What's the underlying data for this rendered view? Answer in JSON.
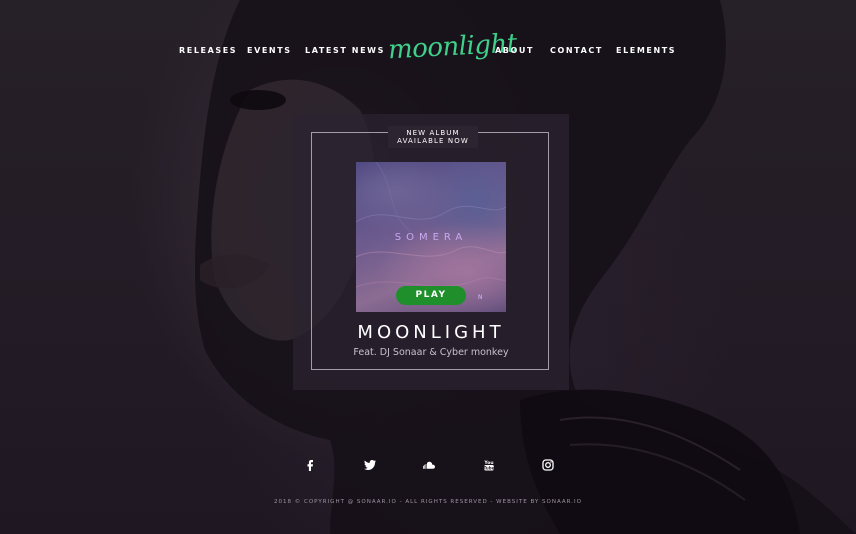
{
  "nav": {
    "left_items": [
      {
        "label": "RELEASES"
      },
      {
        "label": "EVENTS"
      },
      {
        "label": "LATEST NEWS"
      }
    ],
    "logo": "moonlight",
    "right_items": [
      {
        "label": "ABOUT"
      },
      {
        "label": "CONTACT"
      },
      {
        "label": "ELEMENTS"
      }
    ]
  },
  "album": {
    "label_line1": "NEW ALBUM",
    "label_line2": "AVAILABLE NOW",
    "cover_title": "SOMERA",
    "cover_mark": "N",
    "play_label": "PLAY",
    "title": "MOONLIGHT",
    "subtitle": "Feat. DJ Sonaar & Cyber monkey"
  },
  "social": [
    {
      "icon": "facebook-icon"
    },
    {
      "icon": "twitter-icon"
    },
    {
      "icon": "soundcloud-icon"
    },
    {
      "icon": "youtube-icon"
    },
    {
      "icon": "instagram-icon"
    }
  ],
  "footer": {
    "text": "2018 © COPYRIGHT @ SONAAR.IO -  ALL RIGHTS RESERVED - WEBSITE BY SONAAR.IO"
  },
  "colors": {
    "accent": "#3fd08a",
    "play_button": "#1e8f2b",
    "background": "#241c26"
  }
}
